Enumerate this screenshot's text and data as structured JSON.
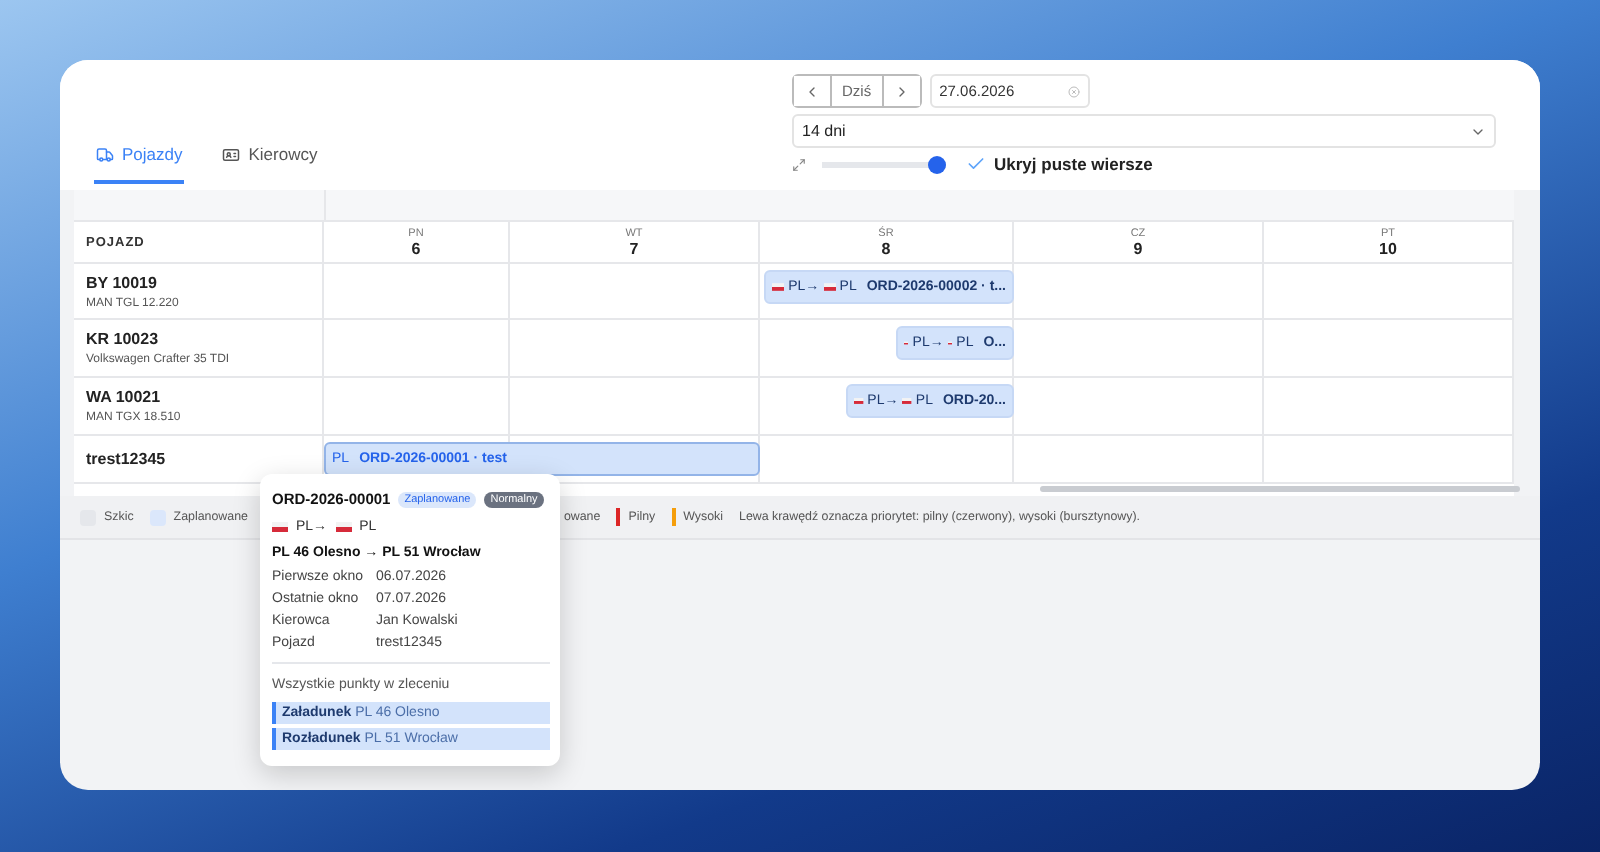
{
  "tabs": [
    {
      "label": "Pojazdy",
      "selected": true
    },
    {
      "label": "Kierowcy",
      "selected": false
    }
  ],
  "toolbar": {
    "today": "Dziś",
    "date": "27.06.2026",
    "range": "14 dni",
    "zoom": {
      "level": 1
    },
    "hide_empty": {
      "label": "Ukryj puste wiersze",
      "checked": true
    }
  },
  "table": {
    "columns": [
      {
        "label": "POJAZD"
      },
      {
        "weekday": "PN",
        "day": "6"
      },
      {
        "weekday": "WT",
        "day": "7"
      },
      {
        "weekday": "ŚR",
        "day": "8"
      },
      {
        "weekday": "CZ",
        "day": "9"
      },
      {
        "weekday": "PT",
        "day": "10"
      }
    ],
    "rows": [
      {
        "vehicle": "BY 10019",
        "model": "MAN TGL 12.220",
        "bar": {
          "route_from": "PL→",
          "route_to": "PL",
          "order": "ORD-2026-00002 · t...",
          "selected": false
        }
      },
      {
        "vehicle": "KR 10023",
        "model": "Volkswagen Crafter 35 TDI",
        "bar": {
          "route_from": "PL→",
          "route_to": "PL",
          "order": "O...",
          "selected": false
        }
      },
      {
        "vehicle": "WA 10021",
        "model": "MAN TGX 18.510",
        "bar": {
          "route_from": "PL→",
          "route_to": "PL",
          "order": "ORD-20...",
          "selected": false
        }
      },
      {
        "vehicle": "trest12345",
        "bar": {
          "route_to": "PL",
          "order": "ORD-2026-00001 · test",
          "selected": true
        }
      }
    ]
  },
  "legend": [
    {
      "kind": "swatch",
      "label": "Szkic",
      "color": "#e5e7eb"
    },
    {
      "kind": "swatch",
      "label": "Zaplanowane",
      "color": "#dbe7fb"
    },
    {
      "kind": "text",
      "label": "owane"
    },
    {
      "kind": "bar",
      "label": "Pilny",
      "color": "#dc2626"
    },
    {
      "kind": "bar",
      "label": "Wysoki",
      "color": "#f59e0b"
    },
    {
      "kind": "text",
      "label": "Lewa krawędź oznacza priorytet: pilny (czerwony), wysoki (bursztynowy)."
    }
  ],
  "tooltip": {
    "order": "ORD-2026-00001",
    "status": "Zaplanowane",
    "priority": "Normalny",
    "route_from": "PL→",
    "route_to": "PL",
    "route": "PL 46 Olesno → PL 51 Wrocław",
    "details": [
      {
        "label": "Pierwsze okno",
        "value": "06.07.2026"
      },
      {
        "label": "Ostatnie okno",
        "value": "07.07.2026"
      },
      {
        "label": "Kierowca",
        "value": "Jan Kowalski"
      },
      {
        "label": "Pojazd",
        "value": "trest12345"
      }
    ],
    "points_title": "Wszystkie punkty w zleceniu",
    "points": [
      {
        "type": "Załadunek",
        "place": "PL 46 Olesno"
      },
      {
        "type": "Rozładunek",
        "place": "PL 51 Wrocław"
      }
    ]
  }
}
